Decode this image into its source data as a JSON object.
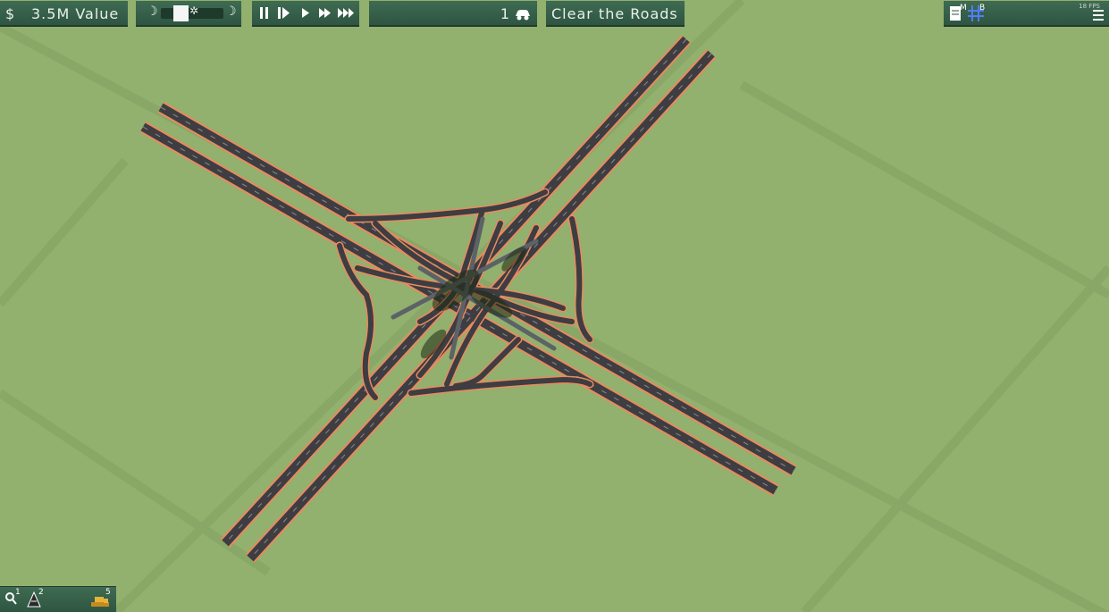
{
  "hud": {
    "currency_symbol": "$",
    "value_text": "3.5M Value",
    "car_count": "1",
    "mission_title": "Clear the Roads",
    "fps_text": "18 FPS",
    "menu_badge_m": "M",
    "menu_badge_b": "B"
  },
  "speed_controls": [
    "pause-icon",
    "step-icon",
    "play-icon",
    "fast-icon",
    "fastest-icon"
  ],
  "toolbar": {
    "tools": [
      {
        "icon": "search-icon",
        "hotkey": "1"
      },
      {
        "icon": "road-cone-icon",
        "hotkey": "2"
      },
      {
        "icon": "bulldozer-icon",
        "hotkey": "5"
      }
    ]
  },
  "colors": {
    "grass": "#92b06e",
    "panel": "#2e5541",
    "road": "#3d3d42",
    "road_edge": "#e98a5f"
  }
}
